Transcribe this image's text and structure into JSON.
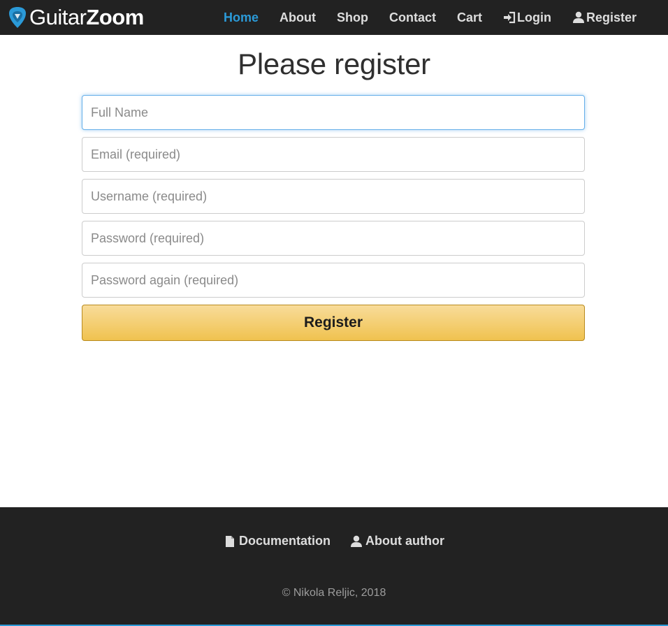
{
  "navbar": {
    "brand": {
      "part1": "Guitar",
      "part2": "Zoom",
      "logo_icon": "guitar-pick-icon"
    },
    "items": [
      {
        "label": "Home",
        "active": true,
        "icon": ""
      },
      {
        "label": "About",
        "active": false,
        "icon": ""
      },
      {
        "label": "Shop",
        "active": false,
        "icon": ""
      },
      {
        "label": "Contact",
        "active": false,
        "icon": ""
      },
      {
        "label": "Cart",
        "active": false,
        "icon": ""
      },
      {
        "label": "Login",
        "active": false,
        "icon": "log-in-icon"
      },
      {
        "label": "Register",
        "active": false,
        "icon": "user-icon"
      }
    ],
    "active_color": "#2b9ad8",
    "background": "#222222"
  },
  "main": {
    "title": "Please register",
    "fields": {
      "full_name": {
        "placeholder": "Full Name",
        "value": ""
      },
      "email": {
        "placeholder": "Email (required)",
        "value": ""
      },
      "username": {
        "placeholder": "Username (required)",
        "value": ""
      },
      "password": {
        "placeholder": "Password (required)",
        "value": ""
      },
      "password_again": {
        "placeholder": "Password again (required)",
        "value": ""
      }
    },
    "submit_label": "Register",
    "button_color": "#f0c24f"
  },
  "footer": {
    "links": [
      {
        "label": "Documentation",
        "icon": "file-icon"
      },
      {
        "label": "About author",
        "icon": "user-icon"
      }
    ],
    "copyright": "© Nikola Reljic, 2018"
  }
}
